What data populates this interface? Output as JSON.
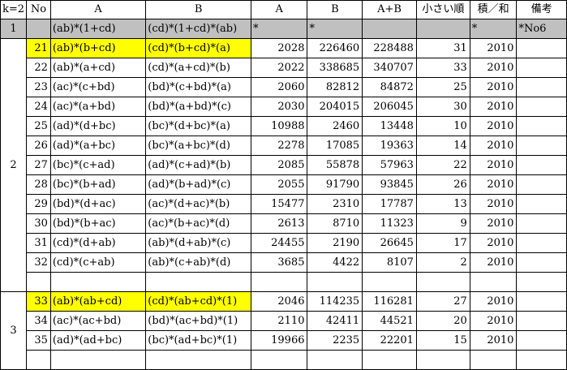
{
  "header": {
    "k": "k=2",
    "no": "No",
    "colA": "A",
    "colB": "B",
    "valA": "A",
    "valB": "B",
    "sum": "A+B",
    "order": "小さい順",
    "ratio": "積／和",
    "note": "備考"
  },
  "ref_row": {
    "k": "1",
    "A": "(ab)*(1+cd)",
    "B": "(cd)*(1+cd)*(ab)",
    "valA": "*",
    "valB": "*",
    "ratio": "*",
    "note": "*No6"
  },
  "groups": [
    {
      "k": "2",
      "rows": [
        {
          "no": "21",
          "A": "(ab)*(b+cd)",
          "B": "(cd)*(b+cd)*(a)",
          "valA": "2028",
          "valB": "226460",
          "sum": "228488",
          "order": "31",
          "ratio": "2010",
          "highlight": true
        },
        {
          "no": "22",
          "A": "(ab)*(a+cd)",
          "B": "(cd)*(a+cd)*(b)",
          "valA": "2022",
          "valB": "338685",
          "sum": "340707",
          "order": "33",
          "ratio": "2010",
          "highlight": false
        },
        {
          "no": "23",
          "A": "(ac)*(c+bd)",
          "B": "(bd)*(c+bd)*(a)",
          "valA": "2060",
          "valB": "82812",
          "sum": "84872",
          "order": "25",
          "ratio": "2010",
          "highlight": false
        },
        {
          "no": "24",
          "A": "(ac)*(a+bd)",
          "B": "(bd)*(a+bd)*(c)",
          "valA": "2030",
          "valB": "204015",
          "sum": "206045",
          "order": "30",
          "ratio": "2010",
          "highlight": false
        },
        {
          "no": "25",
          "A": "(ad)*(d+bc)",
          "B": "(bc)*(d+bc)*(a)",
          "valA": "10988",
          "valB": "2460",
          "sum": "13448",
          "order": "10",
          "ratio": "2010",
          "highlight": false
        },
        {
          "no": "26",
          "A": "(ad)*(a+bc)",
          "B": "(bc)*(a+bc)*(d)",
          "valA": "2278",
          "valB": "17085",
          "sum": "19363",
          "order": "14",
          "ratio": "2010",
          "highlight": false
        },
        {
          "no": "27",
          "A": "(bc)*(c+ad)",
          "B": "(ad)*(c+ad)*(b)",
          "valA": "2085",
          "valB": "55878",
          "sum": "57963",
          "order": "22",
          "ratio": "2010",
          "highlight": false
        },
        {
          "no": "28",
          "A": "(bc)*(b+ad)",
          "B": "(ad)*(b+ad)*(c)",
          "valA": "2055",
          "valB": "91790",
          "sum": "93845",
          "order": "26",
          "ratio": "2010",
          "highlight": false
        },
        {
          "no": "29",
          "A": "(bd)*(d+ac)",
          "B": "(ac)*(d+ac)*(b)",
          "valA": "15477",
          "valB": "2310",
          "sum": "17787",
          "order": "13",
          "ratio": "2010",
          "highlight": false
        },
        {
          "no": "30",
          "A": "(bd)*(b+ac)",
          "B": "(ac)*(b+ac)*(d)",
          "valA": "2613",
          "valB": "8710",
          "sum": "11323",
          "order": "9",
          "ratio": "2010",
          "highlight": false
        },
        {
          "no": "31",
          "A": "(cd)*(d+ab)",
          "B": "(ab)*(d+ab)*(c)",
          "valA": "24455",
          "valB": "2190",
          "sum": "26645",
          "order": "17",
          "ratio": "2010",
          "highlight": false
        },
        {
          "no": "32",
          "A": "(cd)*(c+ab)",
          "B": "(ab)*(c+ab)*(d)",
          "valA": "3685",
          "valB": "4422",
          "sum": "8107",
          "order": "2",
          "ratio": "2010",
          "highlight": false
        }
      ]
    },
    {
      "k": "3",
      "rows": [
        {
          "no": "33",
          "A": "(ab)*(ab+cd)",
          "B": "(cd)*(ab+cd)*(1)",
          "valA": "2046",
          "valB": "114235",
          "sum": "116281",
          "order": "27",
          "ratio": "2010",
          "highlight": true
        },
        {
          "no": "34",
          "A": "(ac)*(ac+bd)",
          "B": "(bd)*(ac+bd)*(1)",
          "valA": "2110",
          "valB": "42411",
          "sum": "44521",
          "order": "20",
          "ratio": "2010",
          "highlight": false
        },
        {
          "no": "35",
          "A": "(ad)*(ad+bc)",
          "B": "(bc)*(ad+bc)*(1)",
          "valA": "19966",
          "valB": "2235",
          "sum": "22201",
          "order": "15",
          "ratio": "2010",
          "highlight": false
        }
      ]
    }
  ],
  "colors": {
    "header_gray": "#c0c0c0",
    "highlight": "#ffff00"
  }
}
